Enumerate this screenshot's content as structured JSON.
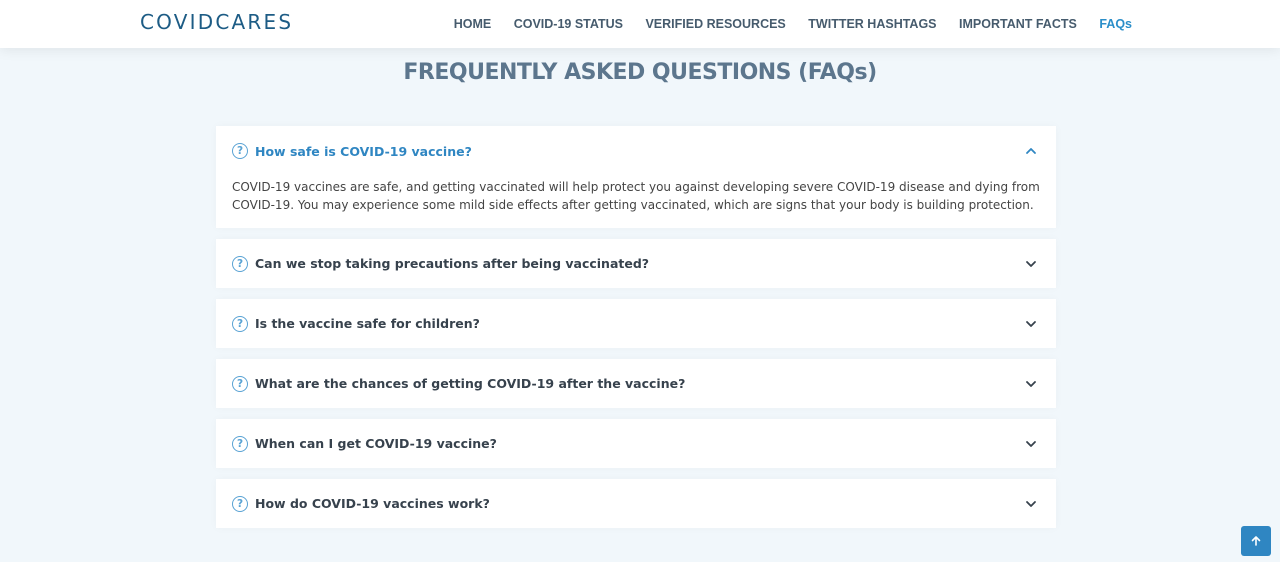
{
  "header": {
    "logo": "COVIDCARES",
    "nav": [
      {
        "label": "HOME",
        "active": false
      },
      {
        "label": "COVID-19 STATUS",
        "active": false
      },
      {
        "label": "VERIFIED RESOURCES",
        "active": false
      },
      {
        "label": "TWITTER HASHTAGS",
        "active": false
      },
      {
        "label": "IMPORTANT FACTS",
        "active": false
      },
      {
        "label": "FAQs",
        "active": true
      }
    ]
  },
  "page_title": "FREQUENTLY ASKED QUESTIONS (FAQs)",
  "faqs": [
    {
      "question": "How safe is COVID-19 vaccine?",
      "expanded": true,
      "answer": "COVID-19 vaccines are safe, and getting vaccinated will help protect you against developing severe COVID-19 disease and dying from COVID-19. You may experience some mild side effects after getting vaccinated, which are signs that your body is building protection."
    },
    {
      "question": "Can we stop taking precautions after being vaccinated?",
      "expanded": false
    },
    {
      "question": "Is the vaccine safe for children?",
      "expanded": false
    },
    {
      "question": "What are the chances of getting COVID-19 after the vaccine?",
      "expanded": false
    },
    {
      "question": "When can I get COVID-19 vaccine?",
      "expanded": false
    },
    {
      "question": "How do COVID-19 vaccines work?",
      "expanded": false
    }
  ],
  "icons": {
    "question": "question-circle-icon",
    "expand": "chevron-down-icon",
    "collapse": "chevron-up-icon",
    "scroll_top": "arrow-up-icon"
  },
  "colors": {
    "brand": "#1d5c85",
    "accent": "#2f86c2",
    "background": "#f1f7fb",
    "title": "#5c768d"
  }
}
